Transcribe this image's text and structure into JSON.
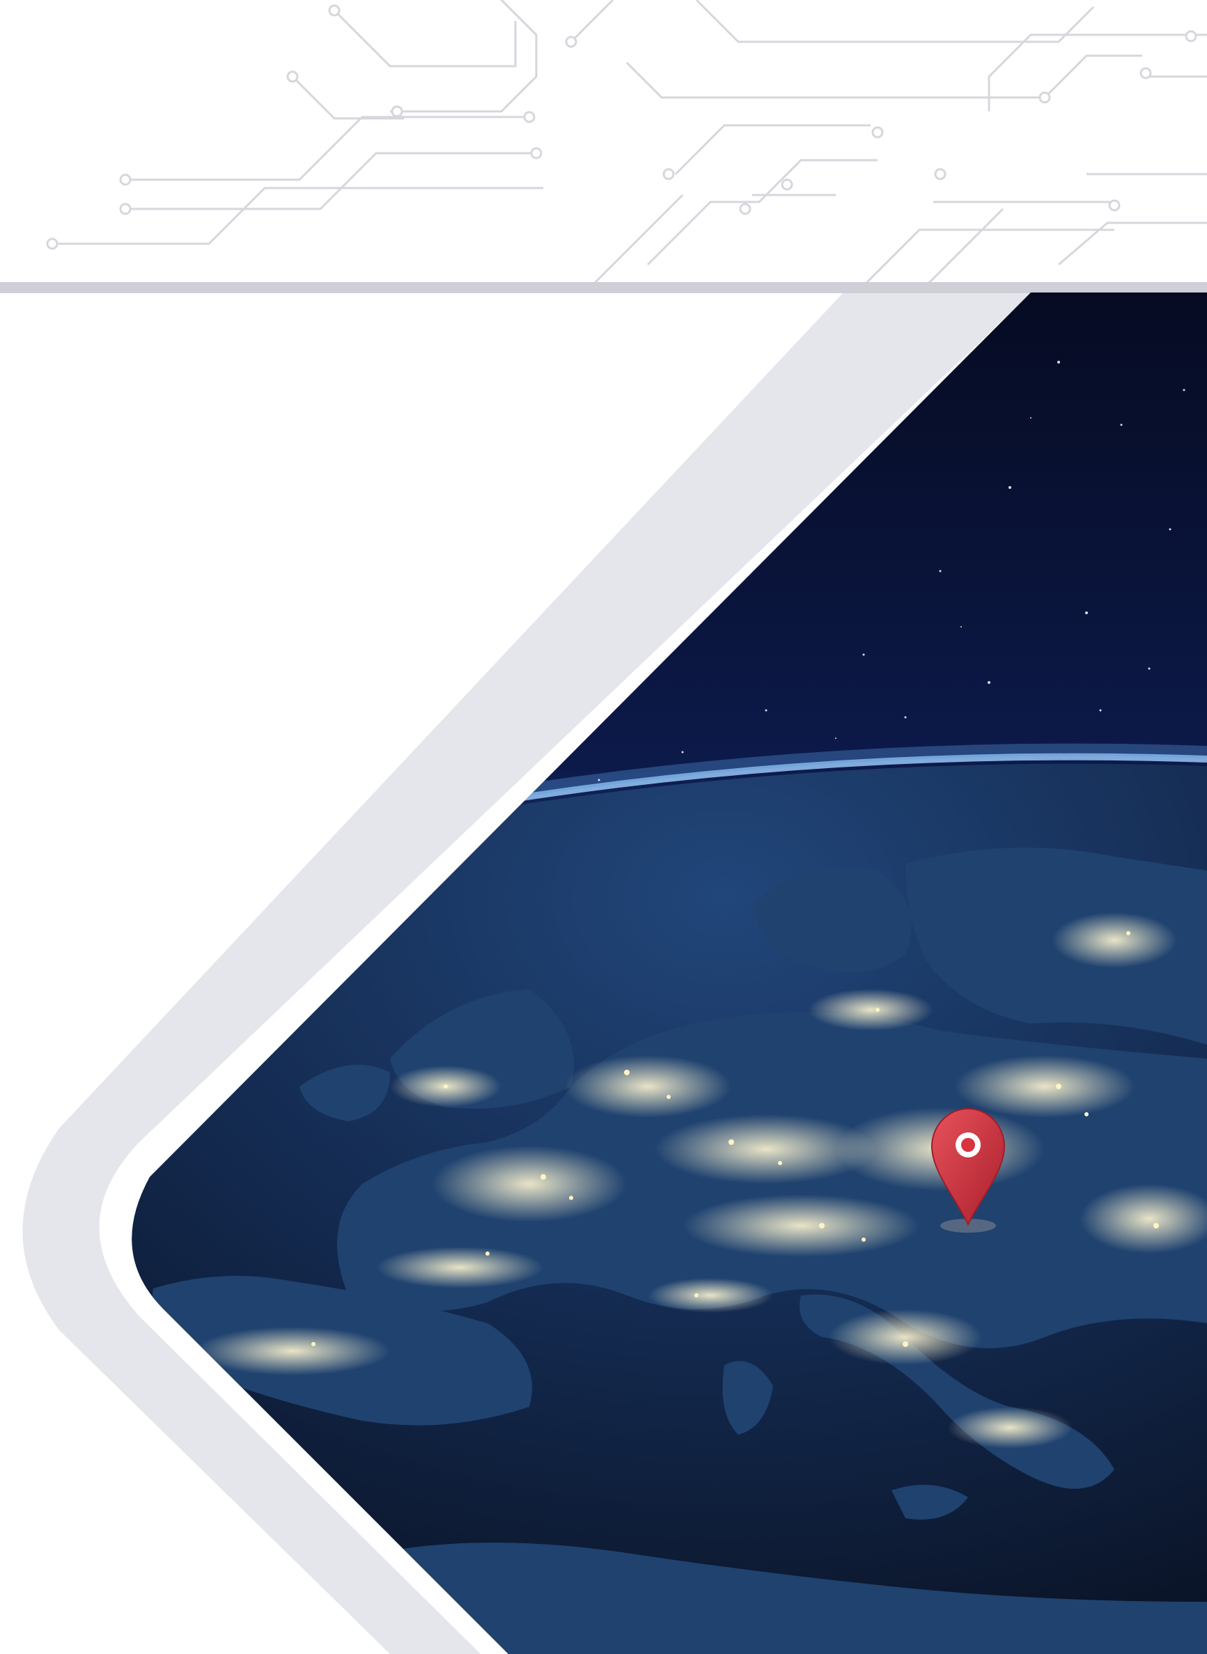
{
  "colors": {
    "page_background": "#ffffff",
    "circuit_lines": "#d6d6dc",
    "header_band": "#cfcfd8",
    "outer_frame": "#e4e6ec",
    "space": "#0a1230",
    "space_deep": "#050a1c",
    "earth_ocean": "#0b1326",
    "earth_land": "#1d3c68",
    "city_lights": "#fff3c4",
    "atmosphere_glow": "#8fc6ff",
    "pin_red": "#d8333f",
    "pin_red_dark": "#9e1d29"
  },
  "icons": {
    "location_pin": "map-pin-icon"
  }
}
